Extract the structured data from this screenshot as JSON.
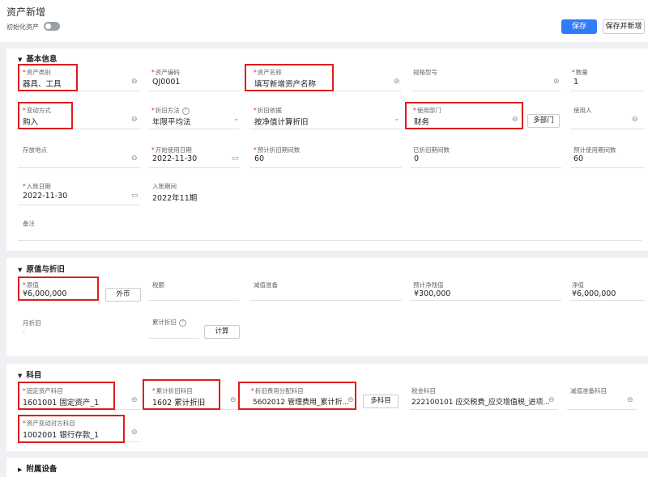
{
  "header": {
    "title": "资产新增",
    "init_label": "初始化资产",
    "save": "保存",
    "save_add": "保存并新增"
  },
  "basic": {
    "title": "基本信息",
    "category": {
      "label": "资产类别",
      "value": "器具、工具"
    },
    "code": {
      "label": "资产编码",
      "value": "QJ0001"
    },
    "name": {
      "label": "资产名称",
      "value": "填写新增资产名称"
    },
    "spec": {
      "label": "规格型号",
      "value": ""
    },
    "qty": {
      "label": "数量",
      "value": "1"
    },
    "change": {
      "label": "变动方式",
      "value": "购入"
    },
    "dep_method": {
      "label": "折旧方法",
      "value": "年限平均法"
    },
    "dep_basis": {
      "label": "折旧依据",
      "value": "按净值计算折旧"
    },
    "dept": {
      "label": "使用部门",
      "value": "财务"
    },
    "multi_dept": "多部门",
    "user": {
      "label": "使用人",
      "value": ""
    },
    "location": {
      "label": "存放地点",
      "value": ""
    },
    "start_date": {
      "label": "开始使用日期",
      "value": "2022-11-30"
    },
    "est_periods": {
      "label": "预计折旧期间数",
      "value": "60"
    },
    "done_periods": {
      "label": "已折旧期间数",
      "value": "0"
    },
    "use_periods": {
      "label": "预计使用期间数",
      "value": "60"
    },
    "entry_date": {
      "label": "入账日期",
      "value": "2022-11-30"
    },
    "entry_period": {
      "label": "入账期间",
      "value": "2022年11期"
    },
    "remark": {
      "label": "备注",
      "value": ""
    }
  },
  "orig": {
    "title": "原值与折旧",
    "original": {
      "label": "原值",
      "value": "¥6,000,000"
    },
    "fx": "外币",
    "tax": {
      "label": "税额",
      "value": ""
    },
    "impair": {
      "label": "减值准备",
      "value": ""
    },
    "salvage": {
      "label": "预计净残值",
      "value": "¥300,000"
    },
    "net": {
      "label": "净值",
      "value": "¥6,000,000"
    },
    "monthly": {
      "label": "月折旧",
      "value": "-"
    },
    "accum": {
      "label": "累计折旧",
      "value": ""
    },
    "calc": "计算"
  },
  "subj": {
    "title": "科目",
    "fixed": {
      "label": "固定资产科目",
      "value": "1601001 固定资产_1"
    },
    "accum": {
      "label": "累计折旧科目",
      "value": "1602 累计折旧"
    },
    "alloc": {
      "label": "折旧费用分配科目",
      "value": "5602012 管理费用_累计折..."
    },
    "multi": "多科目",
    "tax": {
      "label": "税金科目",
      "value": "222100101 应交税费_应交增值税_进项..."
    },
    "impair": {
      "label": "减值准备科目",
      "value": ""
    },
    "contra": {
      "label": "资产变动对方科目",
      "value": "1002001 银行存款_1"
    }
  },
  "attach": {
    "title": "附属设备"
  }
}
